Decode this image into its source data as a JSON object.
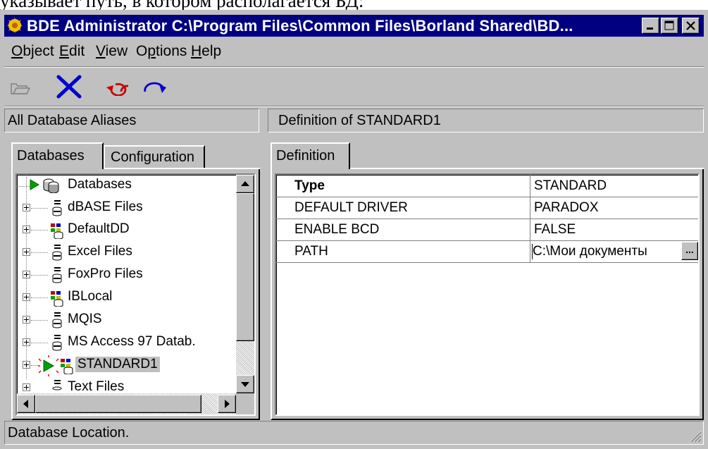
{
  "context_text": "указывает путь, в котором располагается БД:",
  "window": {
    "title": "BDE Administrator  C:\\Program Files\\Common Files\\Borland Shared\\BD...",
    "controls": [
      "minimize",
      "maximize",
      "close"
    ]
  },
  "menu": {
    "items": [
      {
        "label": "Object",
        "accel": "O"
      },
      {
        "label": "Edit",
        "accel": "E"
      },
      {
        "label": "View",
        "accel": "V"
      },
      {
        "label": "Options",
        "accel": "p"
      },
      {
        "label": "Help",
        "accel": "H"
      }
    ]
  },
  "toolbar": {
    "icons": [
      "open-folder-icon",
      "delete-x-icon",
      "undo-icon",
      "redo-icon"
    ],
    "colors": {
      "delete": "#0000cc",
      "undo": "#cc0000",
      "redo": "#0000cc"
    }
  },
  "left_panel": {
    "header": "All Database Aliases",
    "tabs": [
      "Databases",
      "Configuration"
    ],
    "active_tab": "Databases",
    "tree": {
      "root": "Databases",
      "items": [
        {
          "label": "dBASE Files",
          "icon": "db-standard-icon"
        },
        {
          "label": "DefaultDD",
          "icon": "db-server-icon"
        },
        {
          "label": "Excel Files",
          "icon": "db-standard-icon"
        },
        {
          "label": "FoxPro Files",
          "icon": "db-standard-icon"
        },
        {
          "label": "IBLocal",
          "icon": "db-server-icon"
        },
        {
          "label": "MQIS",
          "icon": "db-standard-icon"
        },
        {
          "label": "MS Access 97 Datab.",
          "icon": "db-standard-icon"
        },
        {
          "label": "STANDARD1",
          "icon": "db-server-icon",
          "selected": true,
          "open": true
        },
        {
          "label": "Text Files",
          "icon": "db-standard-icon"
        }
      ]
    }
  },
  "right_panel": {
    "header": "Definition of STANDARD1",
    "tabs": [
      "Definition"
    ],
    "rows": [
      {
        "key": "Type",
        "value": "STANDARD",
        "bold": true
      },
      {
        "key": "DEFAULT DRIVER",
        "value": "PARADOX"
      },
      {
        "key": "ENABLE BCD",
        "value": "FALSE"
      },
      {
        "key": "PATH",
        "value": "C:\\Мои документы",
        "has_button": true,
        "button_label": "..."
      }
    ]
  },
  "status": {
    "text": "Database Location."
  }
}
